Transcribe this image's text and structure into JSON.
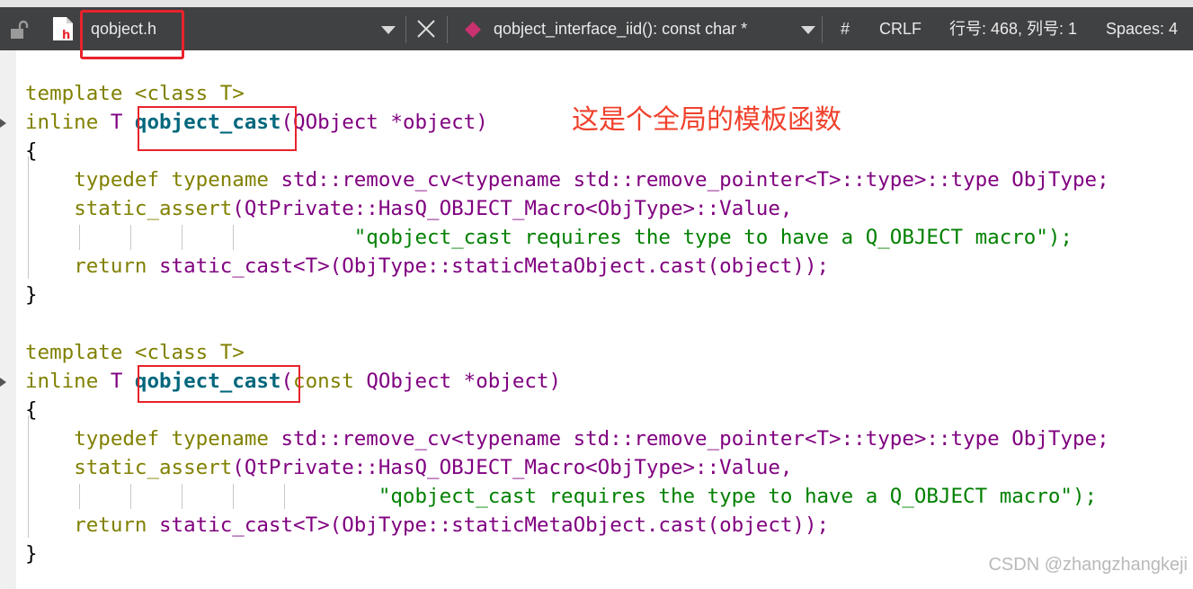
{
  "toolbar": {
    "file_name": "qobject.h",
    "function_name": "qobject_interface_iid(): const char *",
    "hash_label": "#",
    "line_ending": "CRLF",
    "cursor_position": "行号: 468, 列号: 1",
    "indentation": "Spaces: 4",
    "lock_icon": "unlock-icon",
    "file_icon": "header-file-icon",
    "symbol_icon": "function-diamond-icon",
    "close_icon": "close-icon",
    "dropdown_icon": "chevron-down-icon"
  },
  "annotation_text": "这是个全局的模板函数",
  "watermark": "CSDN @zhangzhangkeji",
  "colors": {
    "toolbar_bg": "#404143",
    "highlight_box": "#e8232b",
    "keyword": "#808000",
    "type": "#800080",
    "function": "#00677c",
    "string": "#008000"
  },
  "code": {
    "template_kw": "template",
    "class_decl": "<class T>",
    "inline_kw": "inline",
    "ret_type": "T",
    "func": "qobject_cast",
    "param1": "(QObject *object)",
    "param2_const": "const",
    "param2_rest": "QObject *object)",
    "open_brace": "{",
    "close_brace": "}",
    "typedef_kw": "typedef typename",
    "typedef_rest": "std::remove_cv<typename std::remove_pointer<T>::type>::type ObjType;",
    "static_assert": "static_assert",
    "assert_args": "(QtPrivate::HasQ_OBJECT_Macro<ObjType>::Value,",
    "assert_msg": "\"qobject_cast requires the type to have a Q_OBJECT macro\");",
    "return_kw": "return",
    "return_rest": "static_cast<T>(ObjType::staticMetaObject.cast(object));"
  }
}
